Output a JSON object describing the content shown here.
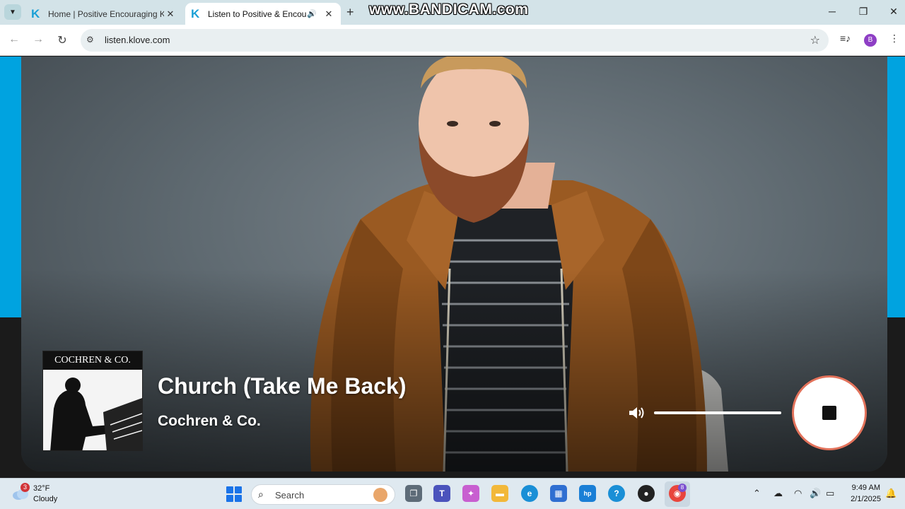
{
  "browser": {
    "tabs": [
      {
        "title": "Home | Positive Encouraging K",
        "active": false
      },
      {
        "title": "Listen to Positive & Encoura",
        "active": true,
        "audio": true
      }
    ],
    "new_tab_label": "+",
    "url": "listen.klove.com",
    "profile_initial": "B",
    "watermark": "www.BANDICAM.com"
  },
  "player": {
    "album_band_text": "COCHREN & CO.",
    "song_title": "Church (Take Me Back)",
    "artist": "Cochren & Co.",
    "volume_level": 1.0,
    "state": "playing",
    "stop_button_color": "#e2725b"
  },
  "colors": {
    "brand_blue": "#00a3e0",
    "tab_strip": "#d3e3e8"
  },
  "taskbar": {
    "weather_temp": "32°F",
    "weather_condition": "Cloudy",
    "weather_badge": "3",
    "search_label": "Search",
    "chrome_badge": "8",
    "time": "9:49 AM",
    "date": "2/1/2025"
  }
}
